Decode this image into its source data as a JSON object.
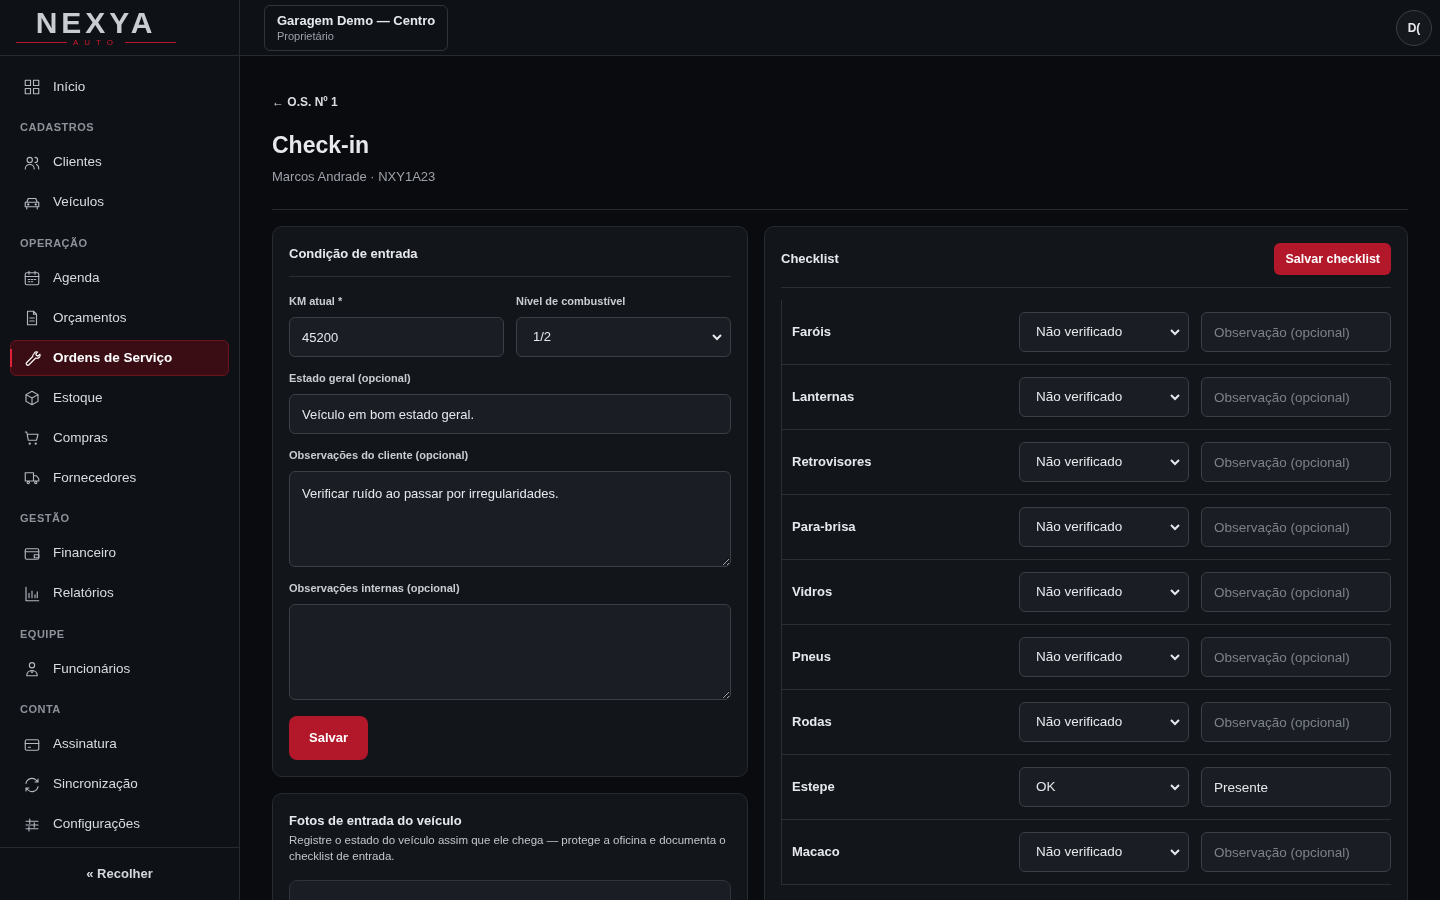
{
  "logo": {
    "wordmark": "NEXYA",
    "tagline": "AUTO"
  },
  "workspace": {
    "name": "Garagem Demo — Centro",
    "role": "Proprietário"
  },
  "avatar": {
    "initials": "D("
  },
  "sidebar": {
    "items": [
      {
        "label": "Início",
        "selected": false
      }
    ],
    "sections": [
      {
        "title": "CADASTROS",
        "items": [
          {
            "label": "Clientes",
            "selected": false
          },
          {
            "label": "Veículos",
            "selected": false
          }
        ]
      },
      {
        "title": "OPERAÇÃO",
        "items": [
          {
            "label": "Agenda",
            "selected": false
          },
          {
            "label": "Orçamentos",
            "selected": false
          },
          {
            "label": "Ordens de Serviço",
            "selected": true
          },
          {
            "label": "Estoque",
            "selected": false
          },
          {
            "label": "Compras",
            "selected": false
          },
          {
            "label": "Fornecedores",
            "selected": false
          }
        ]
      },
      {
        "title": "GESTÃO",
        "items": [
          {
            "label": "Financeiro",
            "selected": false
          },
          {
            "label": "Relatórios",
            "selected": false
          }
        ]
      },
      {
        "title": "EQUIPE",
        "items": [
          {
            "label": "Funcionários",
            "selected": false
          }
        ]
      },
      {
        "title": "CONTA",
        "items": [
          {
            "label": "Assinatura",
            "selected": false
          },
          {
            "label": "Sincronização",
            "selected": false
          },
          {
            "label": "Configurações",
            "selected": false
          }
        ]
      }
    ],
    "collapse": "« Recolher"
  },
  "breadcrumb": "← O.S. Nº 1",
  "title": "Check-in",
  "subtitle": "Marcos Andrade · NXY1A23",
  "entry_card": {
    "title": "Condição de entrada",
    "km": {
      "label": "KM atual *",
      "value": "45200"
    },
    "fuel": {
      "label": "Nível de combustível",
      "value": "1/2"
    },
    "general": {
      "label": "Estado geral (opcional)",
      "value": "Veículo em bom estado geral."
    },
    "client_notes": {
      "label": "Observações do cliente (opcional)",
      "value": "Verificar ruído ao passar por irregularidades."
    },
    "internal_notes": {
      "label": "Observações internas (opcional)"
    },
    "save": "Salvar"
  },
  "photos_card": {
    "title": "Fotos de entrada do veículo",
    "description": "Registre o estado do veículo assim que ele chega — protege a oficina e documenta o checklist de entrada."
  },
  "checklist": {
    "title": "Checklist",
    "save": "Salvar checklist",
    "rows": [
      {
        "label": "Faróis",
        "status": "Não verificado",
        "note": {
          "placeholder": "Observação (opcional)"
        }
      },
      {
        "label": "Lanternas",
        "status": "Não verificado",
        "note": {
          "placeholder": "Observação (opcional)"
        }
      },
      {
        "label": "Retrovisores",
        "status": "Não verificado",
        "note": {
          "placeholder": "Observação (opcional)"
        }
      },
      {
        "label": "Para-brisa",
        "status": "Não verificado",
        "note": {
          "placeholder": "Observação (opcional)"
        }
      },
      {
        "label": "Vidros",
        "status": "Não verificado",
        "note": {
          "placeholder": "Observação (opcional)"
        }
      },
      {
        "label": "Pneus",
        "status": "Não verificado",
        "note": {
          "placeholder": "Observação (opcional)"
        }
      },
      {
        "label": "Rodas",
        "status": "Não verificado",
        "note": {
          "placeholder": "Observação (opcional)"
        }
      },
      {
        "label": "Estepe",
        "status": "OK",
        "note": {
          "value": "Presente"
        }
      },
      {
        "label": "Macaco",
        "status": "Não verificado",
        "note": {
          "placeholder": "Observação (opcional)"
        }
      }
    ]
  }
}
